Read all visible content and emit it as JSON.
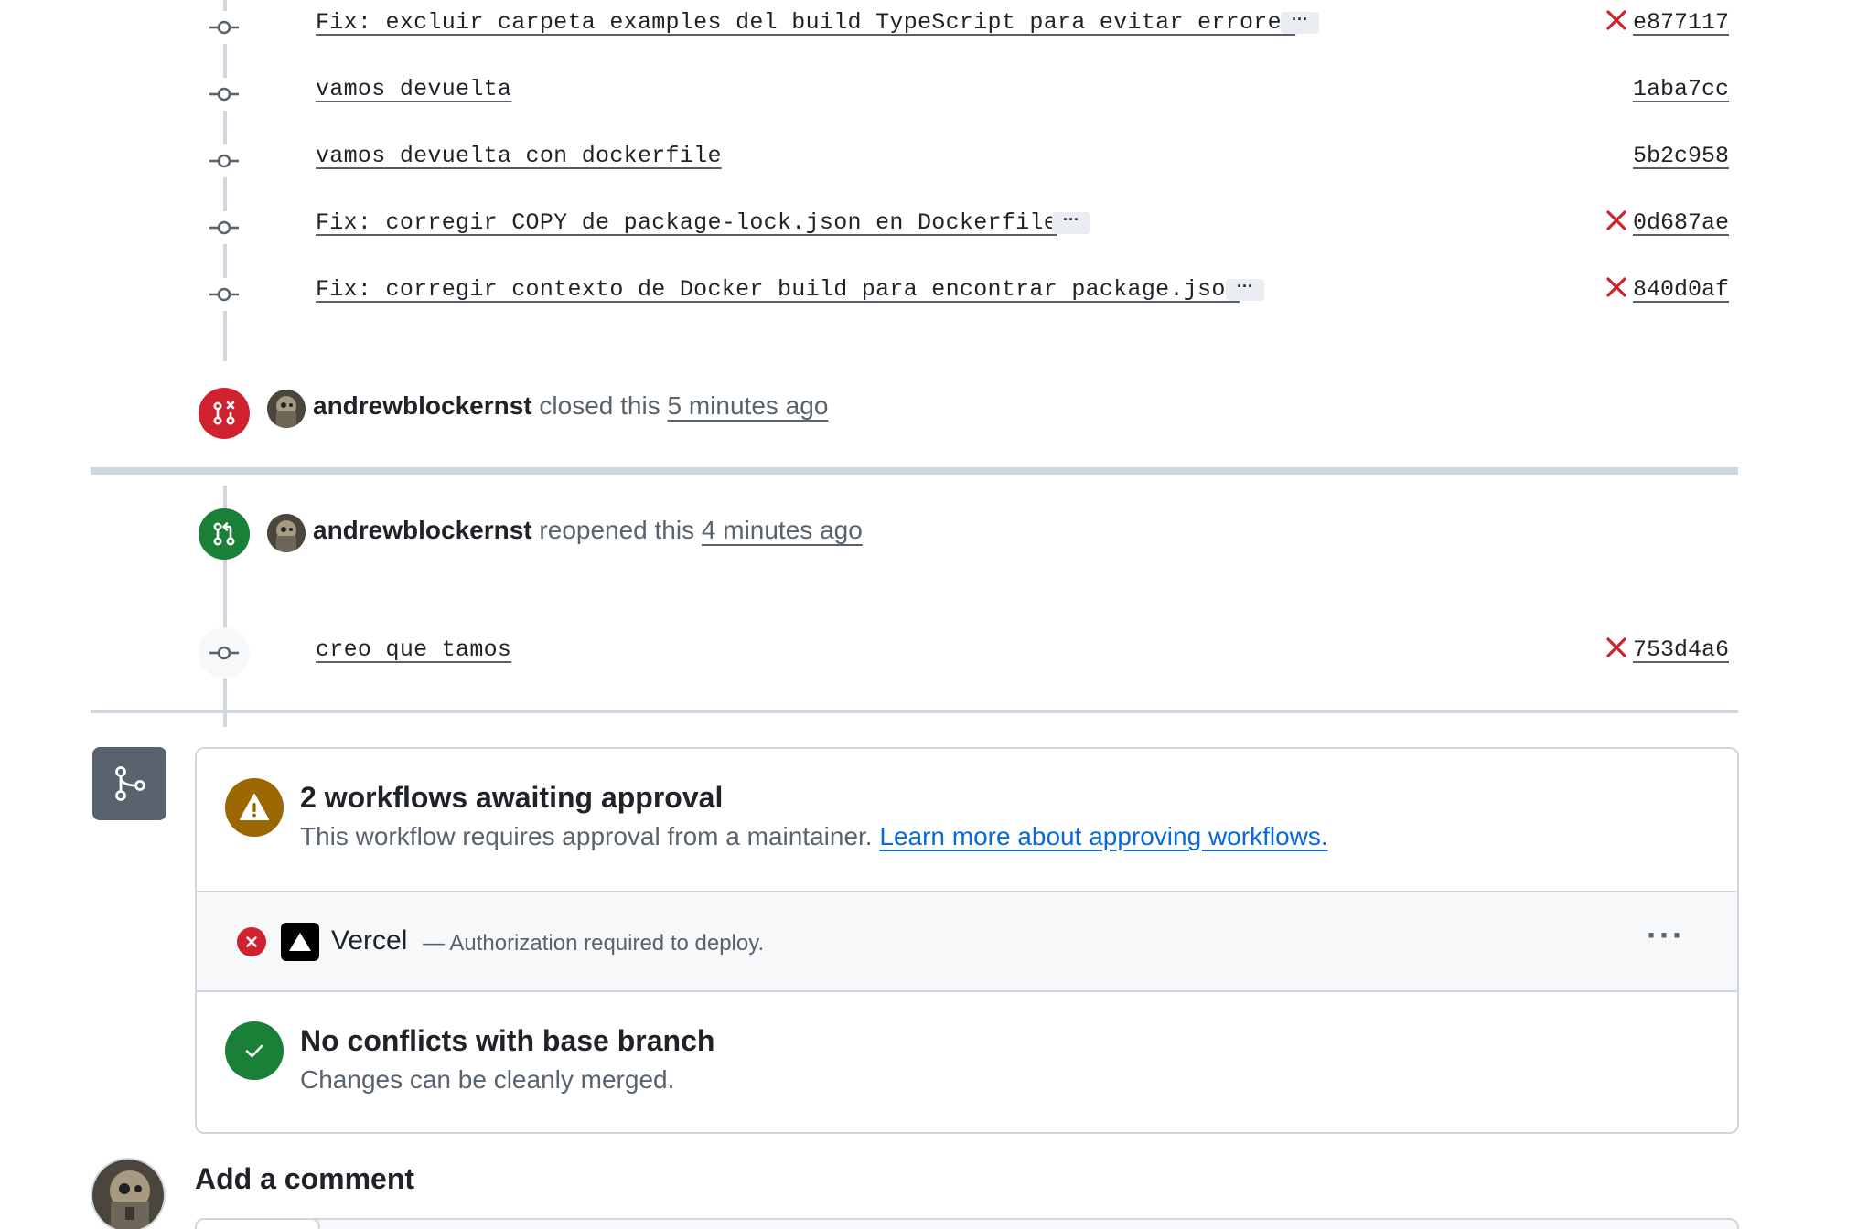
{
  "commits_top": [
    {
      "message": "Fix: excluir carpeta examples del build TypeScript para evitar errore…",
      "has_more": true,
      "failed": true,
      "sha": "e877117"
    },
    {
      "message": "vamos devuelta",
      "has_more": false,
      "failed": false,
      "sha": "1aba7cc"
    },
    {
      "message": "vamos devuelta con dockerfile",
      "has_more": false,
      "failed": false,
      "sha": "5b2c958"
    },
    {
      "message": "Fix: corregir COPY de package-lock.json en Dockerfile",
      "has_more": true,
      "failed": true,
      "sha": "0d687ae"
    },
    {
      "message": "Fix: corregir contexto de Docker build para encontrar package.json",
      "has_more": true,
      "failed": true,
      "sha": "840d0af"
    }
  ],
  "more_glyph": "···",
  "closed_event": {
    "user": "andrewblockernst",
    "action": "closed this",
    "time": "5 minutes ago",
    "badge_color": "#cf222e"
  },
  "reopened_event": {
    "user": "andrewblockernst",
    "action": "reopened this",
    "time": "4 minutes ago",
    "badge_color": "#1a7f37"
  },
  "commit_after": {
    "message": "creo que tamos",
    "failed": true,
    "sha": "753d4a6"
  },
  "merge_box": {
    "workflows": {
      "title": "2 workflows awaiting approval",
      "description": "This workflow requires approval from a maintainer.",
      "link": "Learn more about approving workflows.",
      "icon": "alert-icon",
      "color": "#9a6700"
    },
    "check": {
      "status_icon": "x-circle-icon",
      "app_icon": "vercel-triangle-icon",
      "name": "Vercel",
      "detail": "— Authorization required to deploy.",
      "menu": "···"
    },
    "conflicts": {
      "title": "No conflicts with base branch",
      "description": "Changes can be cleanly merged.",
      "icon": "check-icon",
      "color": "#1a7f37"
    }
  },
  "comment": {
    "heading": "Add a comment"
  },
  "colors": {
    "danger": "#cf222e",
    "success": "#1a7f37",
    "attention": "#9a6700",
    "link": "#0969da",
    "border": "#d0d7de"
  }
}
